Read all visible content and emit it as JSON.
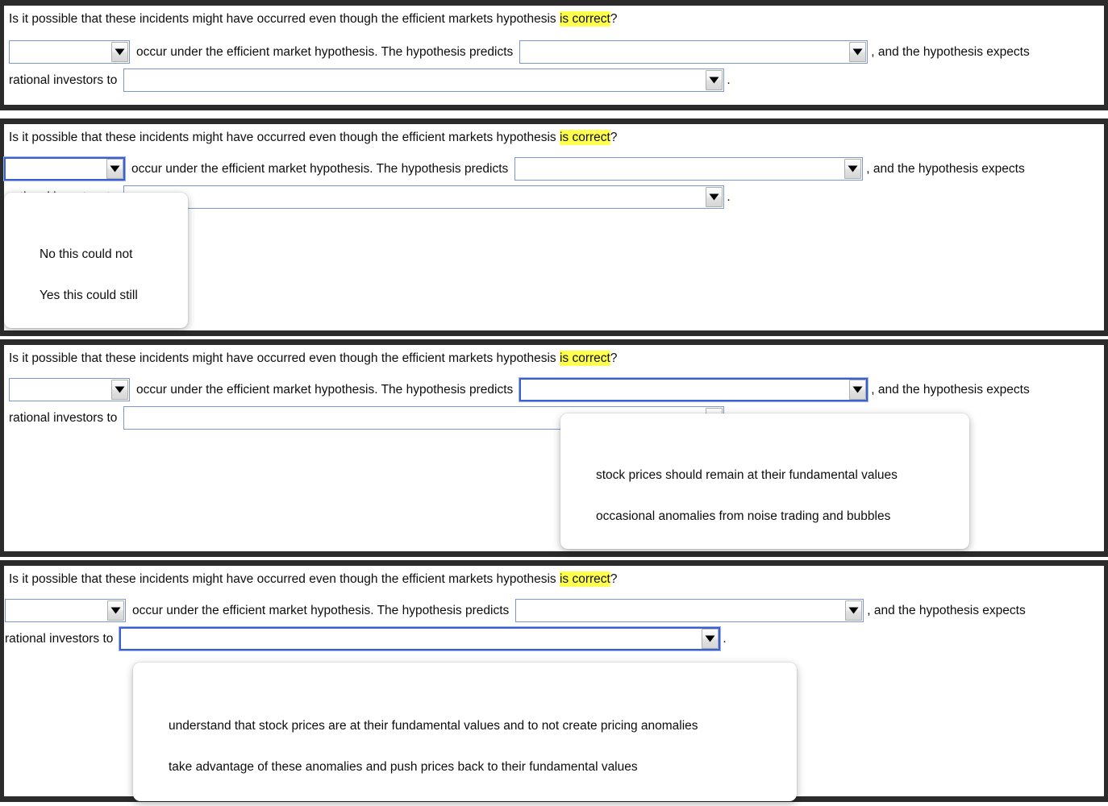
{
  "question": {
    "before_highlight": "Is it possible that these incidents might have occurred even though the efficient markets hypothesis ",
    "highlight": "is correct",
    "after_highlight": "?"
  },
  "sentence": {
    "part1": "occur under the efficient market hypothesis. The hypothesis predicts",
    "part2": ", and the hypothesis expects",
    "part3": "rational investors to",
    "period": "."
  },
  "selects": {
    "possibility": {
      "value": "",
      "placeholder": ""
    },
    "prediction": {
      "value": "",
      "placeholder": ""
    },
    "expectation": {
      "value": "",
      "placeholder": ""
    }
  },
  "dropdowns": {
    "possibility_options": [
      "No this could not",
      "Yes this could still"
    ],
    "prediction_options": [
      "stock prices should remain at their fundamental values",
      "occasional anomalies from noise trading and bubbles"
    ],
    "expectation_options": [
      "understand that stock prices are at their fundamental values and to not create pricing anomalies",
      "take advantage of these anomalies and push prices back to their fundamental values"
    ]
  },
  "icons": {
    "dropdown_arrow": "triangle-down-icon"
  },
  "colors": {
    "highlight": "#ffff4d",
    "select_border": "#7a97d4",
    "select_border_focused": "#3a5fd0",
    "panel_border": "#2b2b2b"
  },
  "panels": [
    {
      "id": "panel-1",
      "open_dropdown": "none"
    },
    {
      "id": "panel-2",
      "open_dropdown": "possibility"
    },
    {
      "id": "panel-3",
      "open_dropdown": "prediction"
    },
    {
      "id": "panel-4",
      "open_dropdown": "expectation"
    }
  ]
}
